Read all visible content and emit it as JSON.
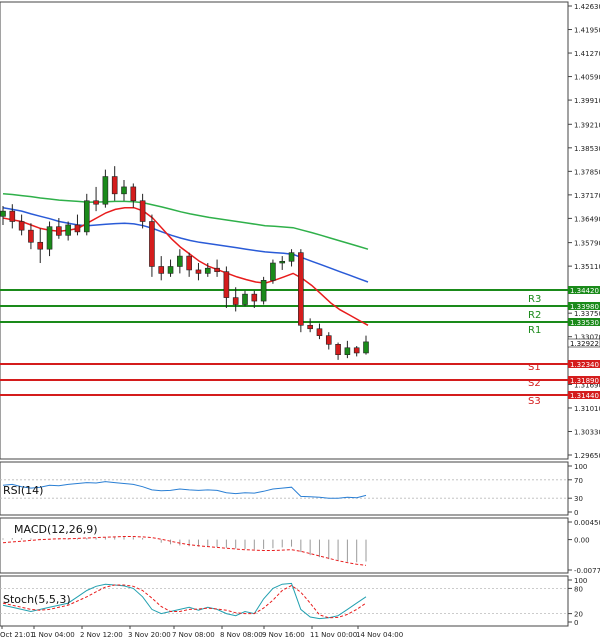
{
  "price_axis": {
    "ticks": [
      "1.42630",
      "1.41950",
      "1.41270",
      "1.40590",
      "1.39910",
      "1.39210",
      "1.38530",
      "1.37850",
      "1.37170",
      "1.36490",
      "1.35790",
      "1.35110",
      "1.33750",
      "1.33070",
      "1.31690",
      "1.31010",
      "1.30330",
      "1.29650"
    ],
    "current": "1.32922"
  },
  "levels": [
    {
      "price": "1.34420",
      "label": "",
      "color": "#1a8a1a"
    },
    {
      "price": "1.33980",
      "label": "R3",
      "color": "#1a8a1a"
    },
    {
      "price": "1.33530",
      "label": "R2",
      "color": "#1a8a1a"
    },
    {
      "price": "",
      "label": "R1",
      "color": "#1a8a1a"
    },
    {
      "price": "1.32340",
      "label": "S1",
      "color": "#d41c1c"
    },
    {
      "price": "1.31890",
      "label": "S2",
      "color": "#d41c1c"
    },
    {
      "price": "1.31440",
      "label": "S3",
      "color": "#d41c1c"
    }
  ],
  "indicators": {
    "rsi": {
      "label": "RSI(14)",
      "ticks": [
        "100",
        "70",
        "30",
        "0"
      ]
    },
    "macd": {
      "label": "MACD(12,26,9)",
      "ticks": [
        "0.004503",
        "0.00",
        "-0.007786"
      ]
    },
    "stoch": {
      "label": "Stoch(5,5,3)",
      "ticks": [
        "100",
        "80",
        "20",
        "0"
      ]
    }
  },
  "time_axis": [
    "Oct 21:01",
    "1 Nov 04:00",
    "2 Nov 12:00",
    "3 Nov 20:00",
    "7 Nov 08:00",
    "8 Nov 08:00",
    "9 Nov 16:00",
    "11 Nov 00:00",
    "14 Nov 04:00"
  ],
  "colors": {
    "bull": "#1a8a1a",
    "bear": "#d41c1c",
    "ma_fast": "#e81c1c",
    "ma_mid": "#2a5bd7",
    "ma_slow": "#2fb04a",
    "rsi": "#2a7fd4",
    "macd_signal": "#e81c1c",
    "stoch_k": "#22a0b0",
    "stoch_d": "#e81c1c"
  },
  "chart_data": {
    "type": "candlestick",
    "candles": [
      {
        "o": 1.3655,
        "h": 1.3685,
        "l": 1.363,
        "c": 1.367
      },
      {
        "o": 1.367,
        "h": 1.369,
        "l": 1.362,
        "c": 1.364
      },
      {
        "o": 1.364,
        "h": 1.366,
        "l": 1.36,
        "c": 1.3615
      },
      {
        "o": 1.3615,
        "h": 1.3635,
        "l": 1.356,
        "c": 1.358
      },
      {
        "o": 1.358,
        "h": 1.362,
        "l": 1.352,
        "c": 1.356
      },
      {
        "o": 1.356,
        "h": 1.364,
        "l": 1.354,
        "c": 1.3625
      },
      {
        "o": 1.3625,
        "h": 1.365,
        "l": 1.359,
        "c": 1.36
      },
      {
        "o": 1.36,
        "h": 1.364,
        "l": 1.3585,
        "c": 1.363
      },
      {
        "o": 1.363,
        "h": 1.366,
        "l": 1.36,
        "c": 1.361
      },
      {
        "o": 1.361,
        "h": 1.372,
        "l": 1.36,
        "c": 1.37
      },
      {
        "o": 1.37,
        "h": 1.374,
        "l": 1.367,
        "c": 1.369
      },
      {
        "o": 1.369,
        "h": 1.379,
        "l": 1.368,
        "c": 1.377
      },
      {
        "o": 1.377,
        "h": 1.38,
        "l": 1.37,
        "c": 1.372
      },
      {
        "o": 1.372,
        "h": 1.376,
        "l": 1.37,
        "c": 1.374
      },
      {
        "o": 1.374,
        "h": 1.375,
        "l": 1.368,
        "c": 1.37
      },
      {
        "o": 1.37,
        "h": 1.372,
        "l": 1.362,
        "c": 1.364
      },
      {
        "o": 1.364,
        "h": 1.366,
        "l": 1.348,
        "c": 1.351
      },
      {
        "o": 1.351,
        "h": 1.354,
        "l": 1.347,
        "c": 1.349
      },
      {
        "o": 1.349,
        "h": 1.353,
        "l": 1.348,
        "c": 1.351
      },
      {
        "o": 1.351,
        "h": 1.356,
        "l": 1.349,
        "c": 1.354
      },
      {
        "o": 1.354,
        "h": 1.355,
        "l": 1.348,
        "c": 1.35
      },
      {
        "o": 1.35,
        "h": 1.352,
        "l": 1.347,
        "c": 1.349
      },
      {
        "o": 1.349,
        "h": 1.352,
        "l": 1.348,
        "c": 1.3505
      },
      {
        "o": 1.3505,
        "h": 1.353,
        "l": 1.348,
        "c": 1.3495
      },
      {
        "o": 1.3495,
        "h": 1.351,
        "l": 1.339,
        "c": 1.342
      },
      {
        "o": 1.342,
        "h": 1.345,
        "l": 1.338,
        "c": 1.34
      },
      {
        "o": 1.34,
        "h": 1.344,
        "l": 1.3395,
        "c": 1.343
      },
      {
        "o": 1.343,
        "h": 1.344,
        "l": 1.339,
        "c": 1.341
      },
      {
        "o": 1.341,
        "h": 1.348,
        "l": 1.34,
        "c": 1.347
      },
      {
        "o": 1.347,
        "h": 1.353,
        "l": 1.346,
        "c": 1.352
      },
      {
        "o": 1.352,
        "h": 1.354,
        "l": 1.35,
        "c": 1.3525
      },
      {
        "o": 1.3525,
        "h": 1.356,
        "l": 1.351,
        "c": 1.355
      },
      {
        "o": 1.355,
        "h": 1.356,
        "l": 1.332,
        "c": 1.334
      },
      {
        "o": 1.334,
        "h": 1.336,
        "l": 1.332,
        "c": 1.333
      },
      {
        "o": 1.333,
        "h": 1.3345,
        "l": 1.33,
        "c": 1.331
      },
      {
        "o": 1.331,
        "h": 1.332,
        "l": 1.327,
        "c": 1.3285
      },
      {
        "o": 1.3285,
        "h": 1.329,
        "l": 1.324,
        "c": 1.3255
      },
      {
        "o": 1.3255,
        "h": 1.3295,
        "l": 1.3245,
        "c": 1.3275
      },
      {
        "o": 1.3275,
        "h": 1.328,
        "l": 1.325,
        "c": 1.326
      },
      {
        "o": 1.326,
        "h": 1.331,
        "l": 1.3255,
        "c": 1.3292
      }
    ],
    "ma_fast": [
      1.365,
      1.3645,
      1.364,
      1.363,
      1.362,
      1.3615,
      1.3612,
      1.3615,
      1.362,
      1.3635,
      1.365,
      1.3665,
      1.3675,
      1.368,
      1.368,
      1.367,
      1.365,
      1.362,
      1.359,
      1.3565,
      1.3545,
      1.3525,
      1.351,
      1.35,
      1.349,
      1.348,
      1.3472,
      1.3465,
      1.3462,
      1.347,
      1.348,
      1.349,
      1.3475,
      1.3455,
      1.343,
      1.3405,
      1.3385,
      1.337,
      1.3355,
      1.334
    ],
    "ma_mid": [
      1.368,
      1.3675,
      1.367,
      1.3662,
      1.3655,
      1.3648,
      1.364,
      1.3635,
      1.363,
      1.3628,
      1.363,
      1.3632,
      1.3634,
      1.3635,
      1.3633,
      1.3628,
      1.362,
      1.361,
      1.36,
      1.3592,
      1.3585,
      1.358,
      1.3576,
      1.3572,
      1.3568,
      1.3564,
      1.356,
      1.3556,
      1.3552,
      1.355,
      1.3548,
      1.3545,
      1.3535,
      1.3525,
      1.3515,
      1.3505,
      1.3495,
      1.3485,
      1.3475,
      1.3465
    ],
    "ma_slow": [
      1.372,
      1.3718,
      1.3715,
      1.3712,
      1.3708,
      1.3705,
      1.3702,
      1.37,
      1.3698,
      1.3696,
      1.3696,
      1.3697,
      1.3698,
      1.3698,
      1.3697,
      1.3694,
      1.3688,
      1.3682,
      1.3675,
      1.3668,
      1.3662,
      1.3657,
      1.3652,
      1.3648,
      1.3644,
      1.364,
      1.3636,
      1.3632,
      1.3628,
      1.3626,
      1.3624,
      1.3622,
      1.3615,
      1.3608,
      1.36,
      1.3592,
      1.3584,
      1.3576,
      1.3568,
      1.356
    ],
    "rsi": [
      58,
      60,
      55,
      52,
      54,
      58,
      57,
      60,
      62,
      64,
      63,
      66,
      64,
      62,
      60,
      55,
      48,
      46,
      47,
      50,
      48,
      47,
      48,
      47,
      42,
      40,
      42,
      41,
      45,
      50,
      52,
      54,
      34,
      33,
      32,
      30,
      30,
      32,
      31,
      36
    ],
    "macd_histogram": [
      0.0003,
      0.0004,
      0.0004,
      0.0003,
      0.0002,
      0.0002,
      0.0002,
      0.0002,
      0.0003,
      0.0004,
      0.0005,
      0.0006,
      0.0007,
      0.0007,
      0.0006,
      0.0004,
      0.0,
      -0.0008,
      -0.0012,
      -0.0015,
      -0.0017,
      -0.0018,
      -0.0019,
      -0.0019,
      -0.0021,
      -0.0023,
      -0.0024,
      -0.0025,
      -0.0024,
      -0.0022,
      -0.002,
      -0.0018,
      -0.0032,
      -0.004,
      -0.0045,
      -0.005,
      -0.0055,
      -0.0057,
      -0.0058,
      -0.0056
    ],
    "macd_signal": [
      -0.0008,
      -0.0006,
      -0.0004,
      -0.0002,
      0.0,
      0.0001,
      0.0002,
      0.0002,
      0.0003,
      0.0004,
      0.0005,
      0.0006,
      0.0007,
      0.0008,
      0.0008,
      0.0007,
      0.0005,
      0.0001,
      -0.0004,
      -0.0009,
      -0.0013,
      -0.0016,
      -0.0018,
      -0.002,
      -0.0022,
      -0.0024,
      -0.0026,
      -0.0027,
      -0.0028,
      -0.0028,
      -0.0027,
      -0.0026,
      -0.003,
      -0.0036,
      -0.0042,
      -0.0048,
      -0.0054,
      -0.0059,
      -0.0063,
      -0.0066
    ],
    "stoch_k": [
      40,
      35,
      30,
      25,
      30,
      35,
      40,
      45,
      60,
      75,
      85,
      90,
      88,
      86,
      80,
      60,
      30,
      20,
      25,
      30,
      35,
      28,
      35,
      30,
      20,
      15,
      25,
      20,
      55,
      80,
      90,
      92,
      30,
      12,
      8,
      10,
      15,
      30,
      45,
      60
    ],
    "stoch_d": [
      45,
      40,
      35,
      30,
      28,
      30,
      35,
      40,
      50,
      60,
      72,
      83,
      88,
      88,
      85,
      75,
      57,
      37,
      25,
      25,
      30,
      31,
      33,
      31,
      28,
      22,
      20,
      20,
      33,
      52,
      75,
      87,
      71,
      45,
      17,
      10,
      11,
      18,
      30,
      45
    ]
  }
}
